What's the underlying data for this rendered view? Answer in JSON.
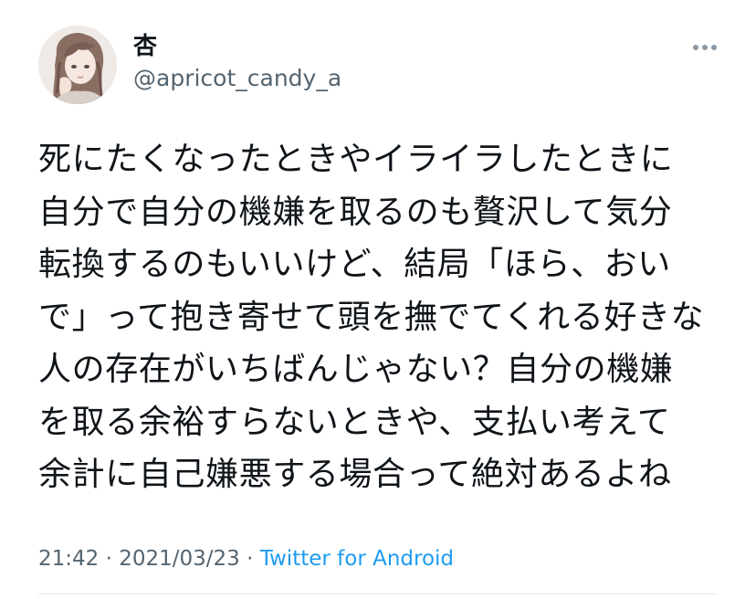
{
  "author": {
    "display_name": "杏",
    "handle": "@apricot_candy_a",
    "avatar_icon": "profile-avatar"
  },
  "menu": {
    "icon": "more-horizontal-icon"
  },
  "tweet": {
    "lines": [
      "死にたくなったときやイライラしたときに",
      "自分で自分の機嫌を取るのも贅沢して気分",
      "転換するのもいいけど、結局「ほら、おい",
      "で」って抱き寄せて頭を撫でてくれる好きな",
      "人の存在がいちばんじゃない？自分の機嫌",
      "を取る余裕すらないときや、支払い考えて",
      "余計に自己嫌悪する場合って絶対あるよね"
    ]
  },
  "meta": {
    "time": "21:42",
    "separator": " · ",
    "date": "2021/03/23",
    "source": "Twitter for Android"
  },
  "colors": {
    "text": "#0f1419",
    "secondary": "#536471",
    "link": "#1d9bf0",
    "divider": "#e7e9ea"
  }
}
